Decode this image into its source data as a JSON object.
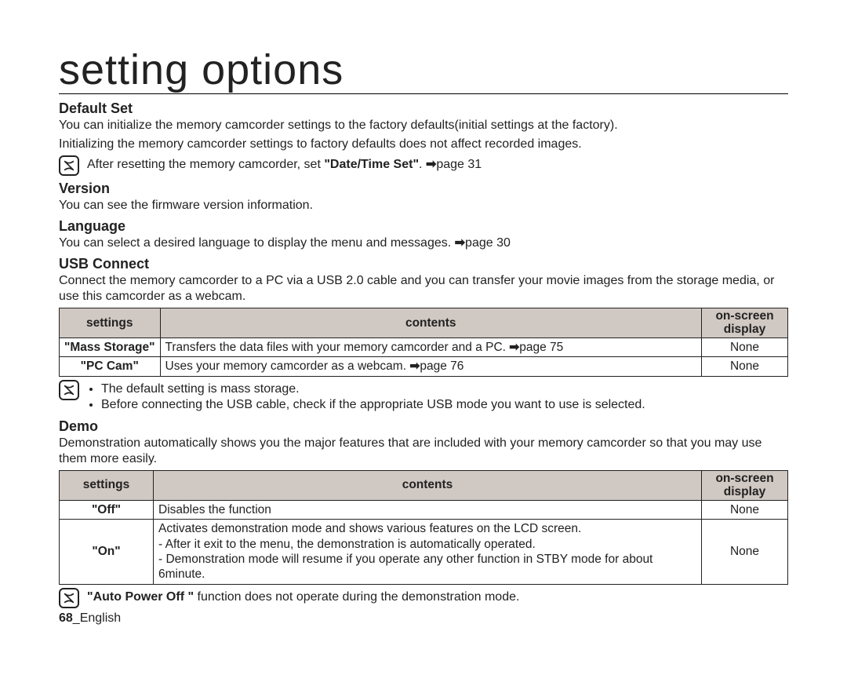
{
  "title": "setting options",
  "sections": {
    "default_set": {
      "heading": "Default Set",
      "body1": "You can initialize the memory camcorder settings to the factory defaults(initial settings at the factory).",
      "body2": "Initializing the memory camcorder settings to factory defaults does not affect recorded images.",
      "note_prefix": "After resetting the memory camcorder, set ",
      "note_bold": "\"Date/Time Set\"",
      "note_suffix": ". ",
      "note_pageref": "page 31"
    },
    "version": {
      "heading": "Version",
      "body": "You can see the firmware version information."
    },
    "language": {
      "heading": "Language",
      "body_prefix": "You can select a desired language to display the menu and messages. ",
      "pageref": "page 30"
    },
    "usb_connect": {
      "heading": "USB Connect",
      "body": "Connect the memory camcorder to a PC via a USB 2.0 cable and you can transfer your movie images from the storage media, or use this camcorder as a webcam.",
      "table": {
        "headers": {
          "settings": "settings",
          "contents": "contents",
          "osd": "on-screen display"
        },
        "rows": [
          {
            "setting": "\"Mass Storage\"",
            "content_prefix": "Transfers the data files with your memory camcorder and a PC. ",
            "pageref": "page 75",
            "osd": "None"
          },
          {
            "setting": "\"PC Cam\"",
            "content_prefix": "Uses your memory camcorder as a webcam. ",
            "pageref": "page 76",
            "osd": "None"
          }
        ]
      },
      "notes": [
        "The default setting is mass storage.",
        "Before connecting the USB cable, check if the appropriate USB mode you want to use is selected."
      ]
    },
    "demo": {
      "heading": "Demo",
      "body": "Demonstration automatically shows you the major features that are included with your memory camcorder so that you may use them more easily.",
      "table": {
        "headers": {
          "settings": "settings",
          "contents": "contents",
          "osd": "on-screen display"
        },
        "rows": [
          {
            "setting": "\"Off\"",
            "content": "Disables the function",
            "osd": "None"
          },
          {
            "setting": "\"On\"",
            "content": "Activates demonstration mode and shows various features on the LCD screen.\n- After it exit to the menu, the demonstration is automatically operated.\n- Demonstration mode will resume if you operate any other function in STBY mode for about 6minute.",
            "osd": "None"
          }
        ]
      },
      "note_bold": "\"Auto Power Off \"",
      "note_rest": " function does not operate during the demonstration mode."
    }
  },
  "footer": {
    "pagenum": "68",
    "lang": "_English"
  },
  "glyphs": {
    "arrow": "➡"
  }
}
